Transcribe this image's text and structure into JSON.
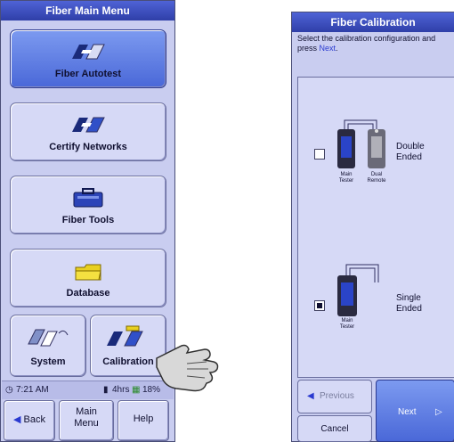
{
  "left_panel": {
    "title": "Fiber Main Menu",
    "menu_items": [
      {
        "label": "Fiber Autotest",
        "icon": "tester-pair-icon",
        "active": true
      },
      {
        "label": "Certify Networks",
        "icon": "tester-pair-icon",
        "active": false
      },
      {
        "label": "Fiber Tools",
        "icon": "toolbox-icon",
        "active": false
      },
      {
        "label": "Database",
        "icon": "database-folder-icon",
        "active": false
      }
    ],
    "small_buttons": [
      {
        "label": "System",
        "icon": "system-devices-icon"
      },
      {
        "label": "Calibration",
        "icon": "calibration-icon"
      }
    ],
    "status": {
      "time": "7:21 AM",
      "battery_a": "4hrs",
      "battery_b": "18%"
    },
    "bottom_buttons": {
      "back": "Back",
      "main_menu": "Main Menu",
      "help": "Help"
    }
  },
  "right_panel": {
    "title": "Fiber Calibration",
    "instruction_prefix": "Select the calibration configuration and press ",
    "instruction_highlight": "Next",
    "instruction_suffix": ".",
    "options": [
      {
        "label": "Double Ended",
        "selected": false,
        "devices": [
          "Main Tester",
          "Dual Remote"
        ]
      },
      {
        "label": "Single Ended",
        "selected": true,
        "devices": [
          "Main Tester"
        ]
      }
    ],
    "buttons": {
      "previous": "Previous",
      "next": "Next",
      "cancel": "Cancel"
    }
  },
  "colors": {
    "panel": "#c9cdf0",
    "accent": "#3a4fd0",
    "title_bar": "#2f3fa8"
  }
}
